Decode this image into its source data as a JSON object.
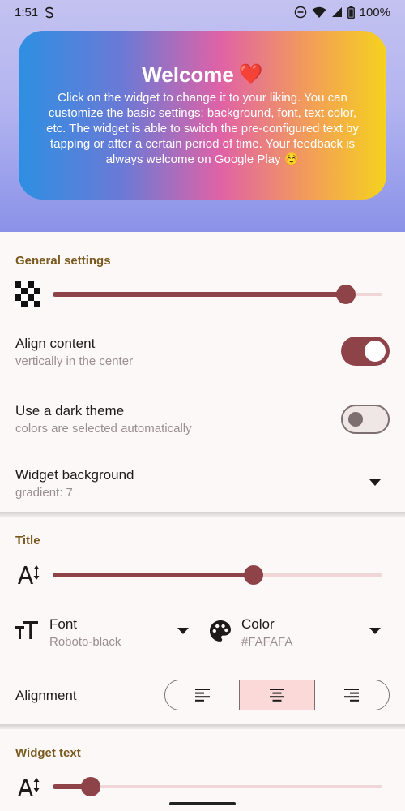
{
  "status_bar": {
    "time": "1:51",
    "battery": "100%"
  },
  "widget": {
    "title": "Welcome",
    "emoji": "❤️",
    "text": "Click on the widget to change it to your liking. You can customize the basic settings: background, font, text color, etc. The widget is able to switch the pre-configured text by tapping or after a certain period of time. Your feedback is always welcome on Google Play ☺️"
  },
  "general_settings": {
    "header": "General settings",
    "transparency_slider": {
      "value": 0.89
    },
    "align_content": {
      "title": "Align content",
      "subtitle": "vertically in the center",
      "enabled": true
    },
    "dark_theme": {
      "title": "Use a dark theme",
      "subtitle": "colors are selected automatically",
      "enabled": false
    },
    "widget_background": {
      "title": "Widget background",
      "value": "gradient: 7"
    }
  },
  "title_section": {
    "header": "Title",
    "size_slider": {
      "value": 0.61
    },
    "font": {
      "label": "Font",
      "value": "Roboto-black"
    },
    "color": {
      "label": "Color",
      "value": "#FAFAFA"
    },
    "alignment": {
      "label": "Alignment",
      "options": [
        "left",
        "center",
        "right"
      ],
      "selected": "center"
    }
  },
  "widget_text_section": {
    "header": "Widget text",
    "size_slider": {
      "value": 0.115
    }
  },
  "colors": {
    "accent": "#8e4349",
    "header": "#7a5a1e",
    "selected_segment": "#fbd9d9"
  }
}
